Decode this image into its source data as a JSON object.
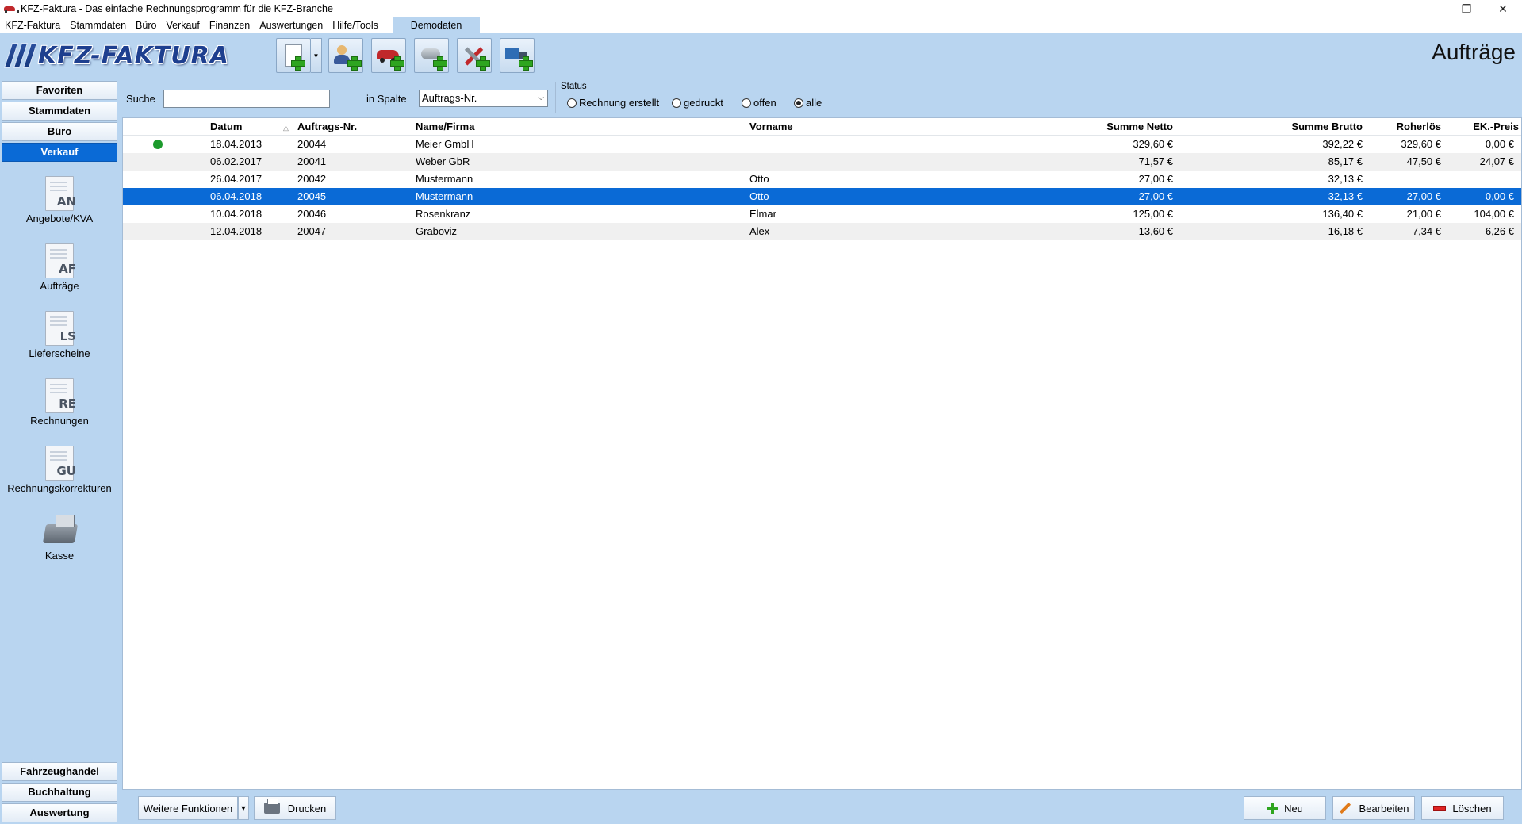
{
  "window": {
    "title": "KFZ-Faktura - Das einfache Rechnungsprogramm für die KFZ-Branche",
    "minimize": "–",
    "restore": "❐",
    "close": "✕"
  },
  "menu": {
    "items": [
      "KFZ-Faktura",
      "Stammdaten",
      "Büro",
      "Verkauf",
      "Finanzen",
      "Auswertungen",
      "Hilfe/Tools"
    ],
    "demo_tab": "Demodaten"
  },
  "header": {
    "logo_text": "KFZ-FAKTURA",
    "page_title": "Aufträge",
    "toolbar_icons": [
      "new-document-icon",
      "new-customer-icon",
      "new-vehicle-icon",
      "new-part-icon",
      "new-service-icon",
      "new-truck-icon"
    ]
  },
  "sidebar": {
    "top": [
      "Favoriten",
      "Stammdaten",
      "Büro",
      "Verkauf"
    ],
    "active": "Verkauf",
    "modules": [
      {
        "code": "AN",
        "label": "Angebote/KVA"
      },
      {
        "code": "AF",
        "label": "Aufträge"
      },
      {
        "code": "LS",
        "label": "Lieferscheine"
      },
      {
        "code": "RE",
        "label": "Rechnungen"
      },
      {
        "code": "GU",
        "label": "Rechnungskorrekturen"
      },
      {
        "code": "",
        "label": "Kasse"
      }
    ],
    "bottom": [
      "Fahrzeughandel",
      "Buchhaltung",
      "Auswertung"
    ]
  },
  "filter": {
    "search_label": "Suche",
    "search_value": "",
    "column_label": "in Spalte",
    "column_value": "Auftrags-Nr.",
    "status_legend": "Status",
    "status_options": [
      "Rechnung erstellt",
      "gedruckt",
      "offen",
      "alle"
    ],
    "status_selected": "alle"
  },
  "table": {
    "columns": [
      "Datum",
      "Auftrags-Nr.",
      "Name/Firma",
      "Vorname",
      "Summe Netto",
      "Summe Brutto",
      "Roherlös",
      "EK.-Preis"
    ],
    "rows": [
      {
        "status": "green",
        "datum": "18.04.2013",
        "nr": "20044",
        "name": "Meier GmbH",
        "vorname": "",
        "netto": "329,60 €",
        "brutto": "392,22 €",
        "roh": "329,60 €",
        "ek": "0,00 €"
      },
      {
        "status": "",
        "datum": "06.02.2017",
        "nr": "20041",
        "name": "Weber GbR",
        "vorname": "",
        "netto": "71,57 €",
        "brutto": "85,17 €",
        "roh": "47,50 €",
        "ek": "24,07 €"
      },
      {
        "status": "",
        "datum": "26.04.2017",
        "nr": "20042",
        "name": "Mustermann",
        "vorname": "Otto",
        "netto": "27,00 €",
        "brutto": "32,13 €",
        "roh": "",
        "ek": ""
      },
      {
        "status": "",
        "datum": "06.04.2018",
        "nr": "20045",
        "name": "Mustermann",
        "vorname": "Otto",
        "netto": "27,00 €",
        "brutto": "32,13 €",
        "roh": "27,00 €",
        "ek": "0,00 €"
      },
      {
        "status": "",
        "datum": "10.04.2018",
        "nr": "20046",
        "name": "Rosenkranz",
        "vorname": "Elmar",
        "netto": "125,00 €",
        "brutto": "136,40 €",
        "roh": "21,00 €",
        "ek": "104,00 €"
      },
      {
        "status": "",
        "datum": "12.04.2018",
        "nr": "20047",
        "name": "Graboviz",
        "vorname": "Alex",
        "netto": "13,60 €",
        "brutto": "16,18 €",
        "roh": "7,34 €",
        "ek": "6,26 €"
      }
    ],
    "selected_row": 3
  },
  "footer": {
    "more_label": "Weitere Funktionen",
    "print_label": "Drucken",
    "new_label": "Neu",
    "edit_label": "Bearbeiten",
    "delete_label": "Löschen"
  },
  "colors": {
    "accent": "#0a6ad6",
    "panel": "#b9d5f0",
    "status_green": "#1c9a2c"
  }
}
